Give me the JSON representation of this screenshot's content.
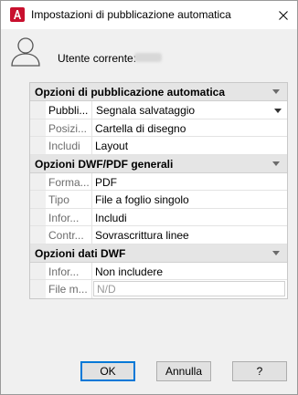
{
  "window": {
    "title": "Impostazioni di pubblicazione automatica",
    "accent": "#c8102e"
  },
  "user": {
    "label": "Utente corrente:",
    "value": "(blurred)"
  },
  "sections": [
    {
      "title": "Opzioni di pubblicazione automatica",
      "rows": [
        {
          "name": "Pubbli...",
          "value": "Segnala salvataggio",
          "type": "dropdown",
          "active": true
        },
        {
          "name": "Posizi...",
          "value": "Cartella di disegno",
          "type": "text"
        },
        {
          "name": "Includi",
          "value": "Layout",
          "type": "text"
        }
      ]
    },
    {
      "title": "Opzioni DWF/PDF generali",
      "rows": [
        {
          "name": "Forma...",
          "value": "PDF",
          "type": "text"
        },
        {
          "name": "Tipo",
          "value": "File a foglio singolo",
          "type": "text"
        },
        {
          "name": "Infor...",
          "value": "Includi",
          "type": "text"
        },
        {
          "name": "Contr...",
          "value": "Sovrascrittura linee",
          "type": "text"
        }
      ]
    },
    {
      "title": "Opzioni dati DWF",
      "rows": [
        {
          "name": "Infor...",
          "value": "Non includere",
          "type": "text"
        },
        {
          "name": "File m...",
          "value": "N/D",
          "type": "disabled"
        }
      ]
    }
  ],
  "buttons": {
    "ok": "OK",
    "cancel": "Annulla",
    "help": "?"
  },
  "icons": {
    "app": "autocad-app-icon",
    "close": "close-icon",
    "user": "user-icon",
    "collapse": "collapse-caret-icon",
    "dropdown": "dropdown-caret-icon"
  }
}
